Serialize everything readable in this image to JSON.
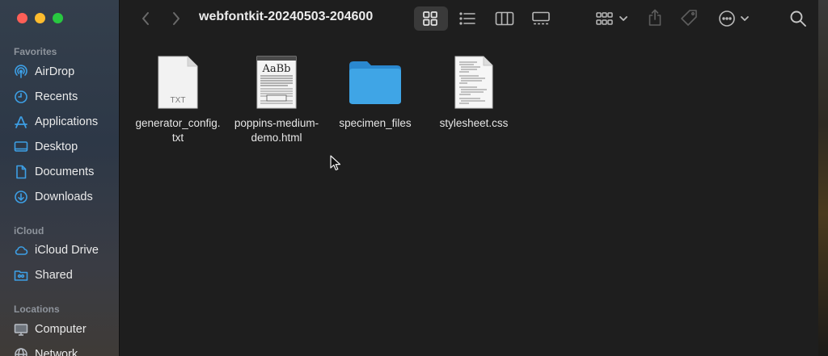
{
  "window": {
    "title": "webfontkit-20240503-204600"
  },
  "sidebar": {
    "sections": [
      {
        "title": "Favorites",
        "items": [
          {
            "label": "AirDrop",
            "icon": "airdrop-icon"
          },
          {
            "label": "Recents",
            "icon": "clock-icon"
          },
          {
            "label": "Applications",
            "icon": "applications-icon"
          },
          {
            "label": "Desktop",
            "icon": "desktop-icon"
          },
          {
            "label": "Documents",
            "icon": "document-icon"
          },
          {
            "label": "Downloads",
            "icon": "download-icon"
          }
        ]
      },
      {
        "title": "iCloud",
        "items": [
          {
            "label": "iCloud Drive",
            "icon": "cloud-icon"
          },
          {
            "label": "Shared",
            "icon": "shared-folder-icon"
          }
        ]
      },
      {
        "title": "Locations",
        "items": [
          {
            "label": "Computer",
            "icon": "computer-icon"
          },
          {
            "label": "Network",
            "icon": "network-icon"
          }
        ]
      }
    ]
  },
  "toolbar": {
    "back_icon": "chevron-left-icon",
    "forward_icon": "chevron-right-icon",
    "views": [
      "icon-view-icon",
      "list-view-icon",
      "column-view-icon",
      "gallery-view-icon"
    ],
    "active_view": "icon-view-icon",
    "group_icon": "group-by-icon",
    "share_icon": "share-icon",
    "tag_icon": "tag-icon",
    "more_icon": "more-icon",
    "search_icon": "search-icon"
  },
  "files": [
    {
      "name_lines": [
        "generator_config.",
        "txt"
      ],
      "kind": "txt",
      "thumb_label": "TXT"
    },
    {
      "name_lines": [
        "poppins-medium-",
        "demo.html"
      ],
      "kind": "html",
      "thumb_label": "AaBb"
    },
    {
      "name_lines": [
        "specimen_files"
      ],
      "kind": "folder",
      "thumb_label": ""
    },
    {
      "name_lines": [
        "stylesheet.css"
      ],
      "kind": "css",
      "thumb_label": ""
    }
  ],
  "colors": {
    "accent": "#3d9fe5",
    "folder": "#3fa5e6",
    "close": "#fe5f57",
    "minimize": "#febc2e",
    "maximize": "#28c840"
  }
}
